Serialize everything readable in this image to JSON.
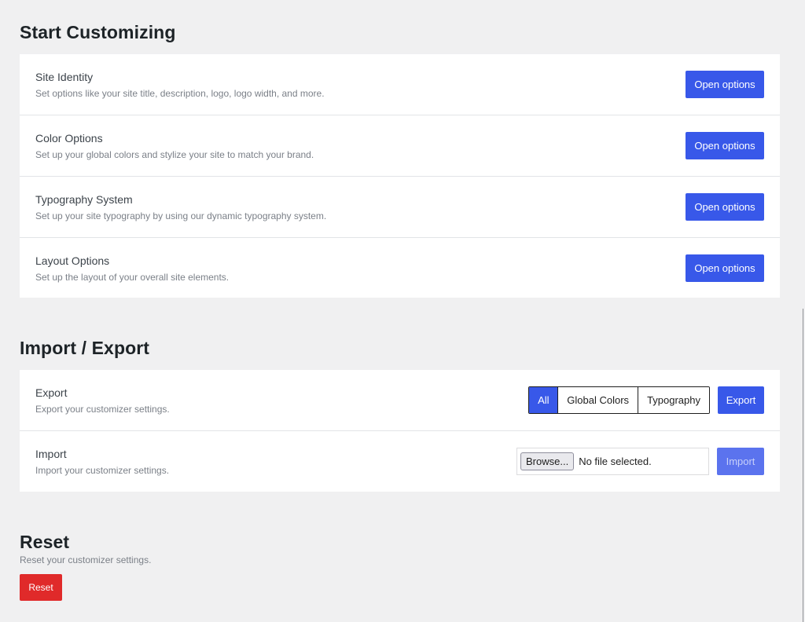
{
  "start": {
    "title": "Start Customizing",
    "rows": [
      {
        "label": "Site Identity",
        "desc": "Set options like your site title, description, logo, logo width, and more.",
        "button": "Open options"
      },
      {
        "label": "Color Options",
        "desc": "Set up your global colors and stylize your site to match your brand.",
        "button": "Open options"
      },
      {
        "label": "Typography System",
        "desc": "Set up your site typography by using our dynamic typography system.",
        "button": "Open options"
      },
      {
        "label": "Layout Options",
        "desc": "Set up the layout of your overall site elements.",
        "button": "Open options"
      }
    ]
  },
  "import_export": {
    "title": "Import / Export",
    "export": {
      "label": "Export",
      "desc": "Export your customizer settings.",
      "segments": [
        "All",
        "Global Colors",
        "Typography"
      ],
      "selected": "All",
      "button": "Export"
    },
    "import": {
      "label": "Import",
      "desc": "Import your customizer settings.",
      "browse": "Browse...",
      "file_status": "No file selected.",
      "button": "Import"
    }
  },
  "reset": {
    "title": "Reset",
    "desc": "Reset your customizer settings.",
    "button": "Reset"
  },
  "colors": {
    "primary": "#3858e9",
    "danger": "#e02a2a",
    "background": "#f0f0f1"
  }
}
